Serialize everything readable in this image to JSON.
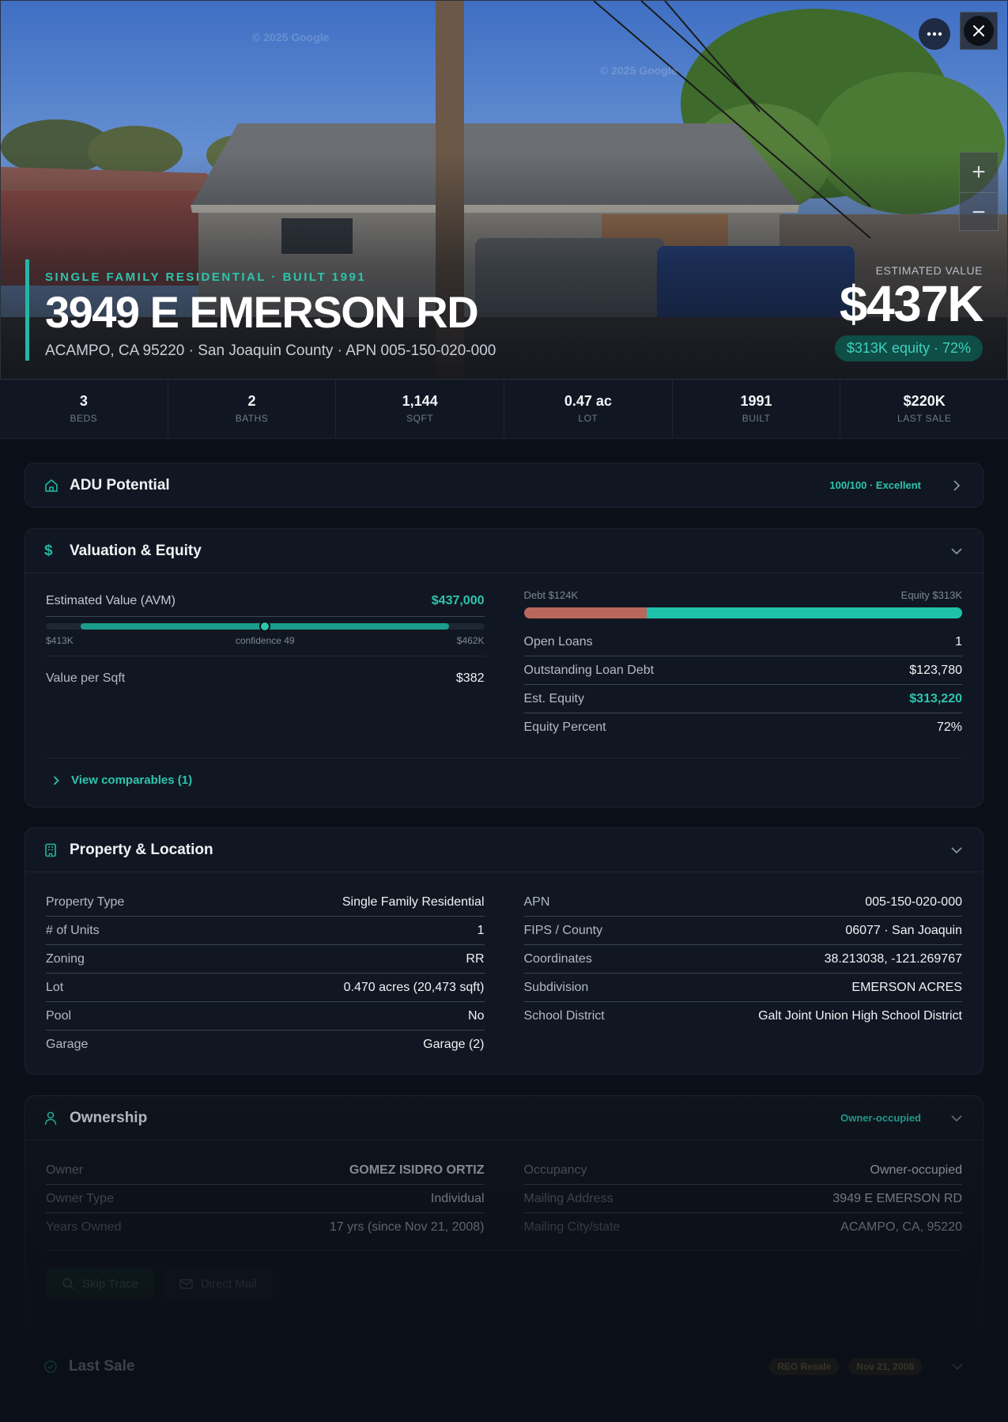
{
  "hero": {
    "kicker": "SINGLE FAMILY RESIDENTIAL · BUILT 1991",
    "title": "3949 E EMERSON RD",
    "subtitle": "ACAMPO, CA 95220 · San Joaquin County · APN 005-150-020-000",
    "price_label": "ESTIMATED VALUE",
    "price": "$437K",
    "equity_pill": "$313K equity · 72%",
    "watermark": "© 2025 Google"
  },
  "stats": [
    {
      "value": "3",
      "label": "BEDS"
    },
    {
      "value": "2",
      "label": "BATHS"
    },
    {
      "value": "1,144",
      "label": "SQFT"
    },
    {
      "value": "0.47 ac",
      "label": "LOT"
    },
    {
      "value": "1991",
      "label": "BUILT"
    },
    {
      "value": "$220K",
      "label": "LAST SALE"
    }
  ],
  "adu": {
    "title": "ADU Potential",
    "badge": "100/100 · Excellent"
  },
  "valuation": {
    "title": "Valuation & Equity",
    "avm_label": "Estimated Value (AVM)",
    "avm_value": "$437,000",
    "range_low": "$413K",
    "range_mid": "confidence 49",
    "range_high": "$462K",
    "value_per_sqft_label": "Value per Sqft",
    "value_per_sqft": "$382",
    "debt_label": "Debt $124K",
    "equity_label": "Equity $313K",
    "equity_fraction": 0.72,
    "rows": [
      {
        "label": "Open Loans",
        "value": "1"
      },
      {
        "label": "Outstanding Loan Debt",
        "value": "$123,780"
      },
      {
        "label": "Est. Equity",
        "value": "$313,220"
      },
      {
        "label": "Equity Percent",
        "value": "72%"
      }
    ],
    "comparables": "View comparables (1)"
  },
  "property": {
    "title": "Property & Location",
    "left": [
      {
        "label": "Property Type",
        "value": "Single Family Residential"
      },
      {
        "label": "# of Units",
        "value": "1"
      },
      {
        "label": "Zoning",
        "value": "RR"
      },
      {
        "label": "Lot",
        "value": "0.470 acres (20,473 sqft)"
      },
      {
        "label": "Pool",
        "value": "No"
      },
      {
        "label": "Garage",
        "value": "Garage (2)"
      }
    ],
    "right": [
      {
        "label": "APN",
        "value": "005-150-020-000"
      },
      {
        "label": "FIPS / County",
        "value": "06077 · San Joaquin"
      },
      {
        "label": "Coordinates",
        "value": "38.213038, -121.269767"
      },
      {
        "label": "Subdivision",
        "value": "EMERSON ACRES"
      },
      {
        "label": "School District",
        "value": "Galt Joint Union High School District"
      }
    ]
  },
  "ownership": {
    "title": "Ownership",
    "badge": "Owner-occupied",
    "left": [
      {
        "label": "Owner",
        "value": "GOMEZ ISIDRO ORTIZ"
      },
      {
        "label": "Owner Type",
        "value": "Individual"
      },
      {
        "label": "Years Owned",
        "value": "17 yrs (since Nov 21, 2008)"
      }
    ],
    "right": [
      {
        "label": "Occupancy",
        "value": "Owner-occupied"
      },
      {
        "label": "Mailing Address",
        "value": "3949 E EMERSON RD"
      },
      {
        "label": "Mailing City/state",
        "value": "ACAMPO, CA, 95220"
      }
    ],
    "skip_trace": "Skip Trace",
    "direct_mail": "Direct Mail"
  },
  "last_sale": {
    "title": "Last Sale",
    "subtitle": "",
    "tag_type": "REO Resale",
    "tag_date": "Nov 21, 2008"
  },
  "colors": {
    "accent": "#22b8a4",
    "debt": "#b9675c",
    "equity": "#1fc1a9"
  }
}
